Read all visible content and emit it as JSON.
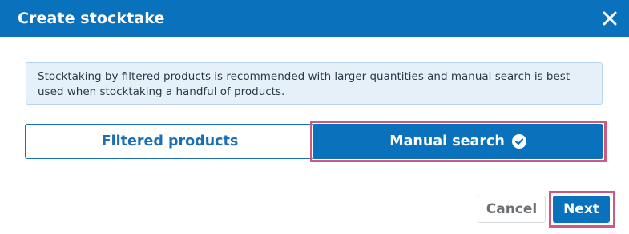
{
  "dialog": {
    "title": "Create stocktake",
    "close_icon": "close-icon"
  },
  "info": {
    "text": "Stocktaking by filtered products is recommended with larger quantities and manual search is best used when stocktaking a handful of products."
  },
  "options": [
    {
      "label": "Filtered products",
      "selected": false
    },
    {
      "label": "Manual search",
      "selected": true,
      "icon": "check-circle-icon"
    }
  ],
  "footer": {
    "cancel_label": "Cancel",
    "next_label": "Next"
  },
  "colors": {
    "primary": "#0a71bd",
    "highlight": "#d05a7d",
    "info_bg": "#e6f0f8"
  }
}
